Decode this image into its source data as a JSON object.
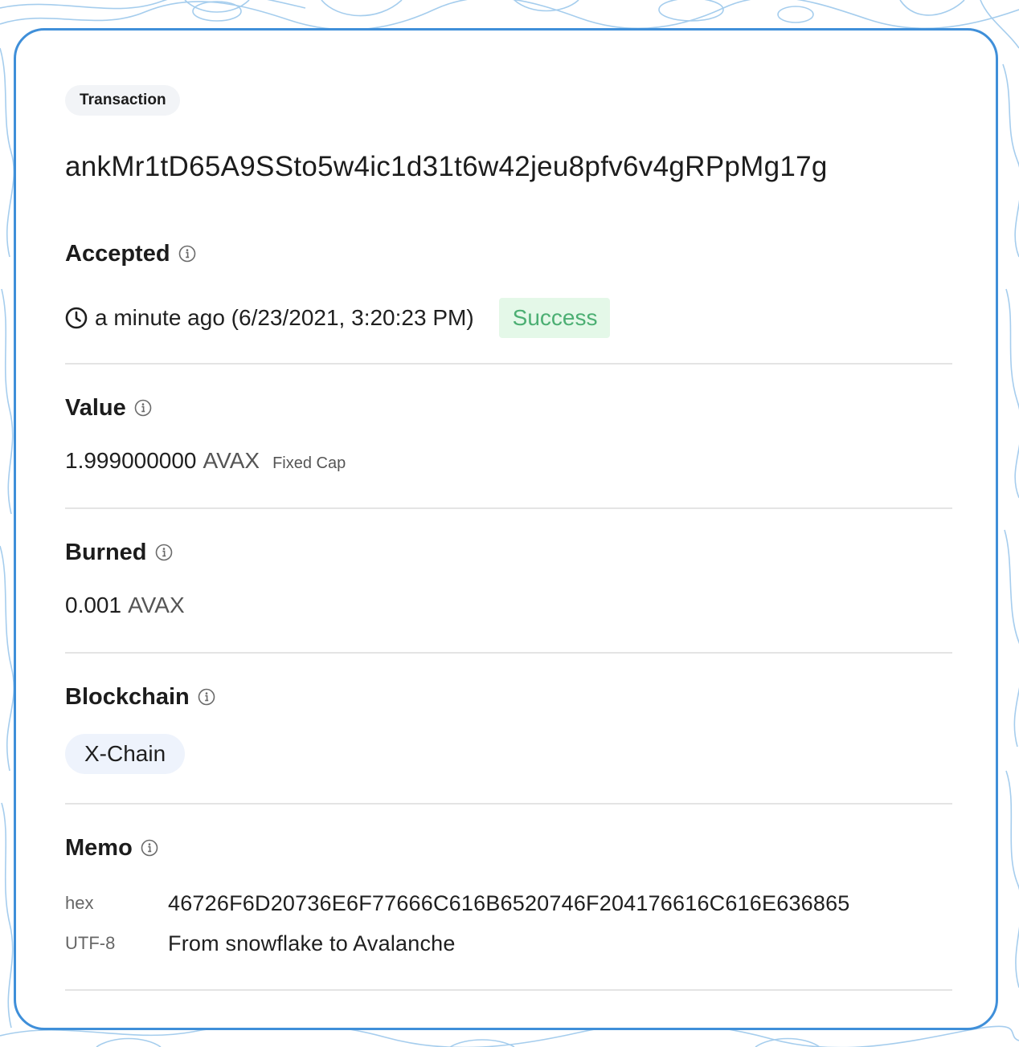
{
  "header": {
    "badge_label": "Transaction",
    "tx_id": "ankMr1tD65A9SSto5w4ic1d31t6w42jeu8pfv6v4gRPpMg17g"
  },
  "accepted": {
    "title": "Accepted",
    "time_text": "a minute ago (6/23/2021, 3:20:23 PM)",
    "status": "Success"
  },
  "value": {
    "title": "Value",
    "amount": "1.999000000",
    "unit": "AVAX",
    "cap_label": "Fixed Cap"
  },
  "burned": {
    "title": "Burned",
    "amount": "0.001",
    "unit": "AVAX"
  },
  "blockchain": {
    "title": "Blockchain",
    "chain": "X-Chain"
  },
  "memo": {
    "title": "Memo",
    "hex_label": "hex",
    "hex_value": "46726F6D20736E6F77666C616B6520746F204176616C616E636865",
    "utf8_label": "UTF-8",
    "utf8_value": "From snowflake to Avalanche"
  },
  "colors": {
    "card_border": "#3f8fd9",
    "success_text": "#4caf73",
    "success_bg": "#e4f8e8",
    "chain_pill_bg": "#eef3fc",
    "divider": "#e4e4e4"
  },
  "icons": {
    "info": "info-circle-icon",
    "clock": "clock-icon"
  }
}
